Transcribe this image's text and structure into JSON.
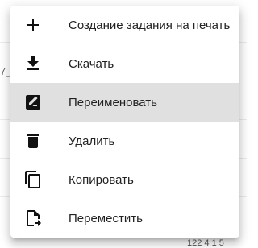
{
  "background": {
    "left_fragment": "7_",
    "bottom_fragment": "122 4 1 5"
  },
  "menu": {
    "highlight_color": "#e0e0e0",
    "items": [
      {
        "label": "Создание задания на печать",
        "icon": "plus-icon"
      },
      {
        "label": "Скачать",
        "icon": "download-icon"
      },
      {
        "label": "Переименовать",
        "icon": "rename-icon",
        "highlighted": true
      },
      {
        "label": "Удалить",
        "icon": "trash-icon"
      },
      {
        "label": "Копировать",
        "icon": "copy-icon"
      },
      {
        "label": "Переместить",
        "icon": "move-file-icon"
      }
    ]
  }
}
